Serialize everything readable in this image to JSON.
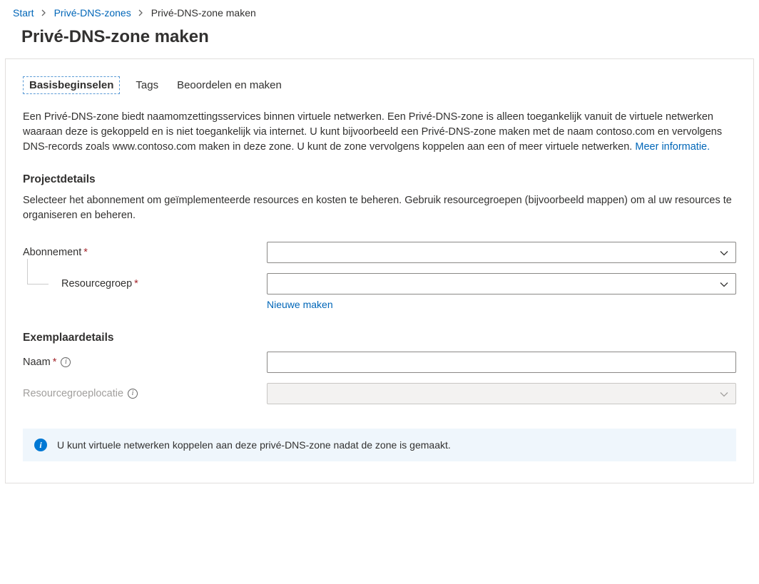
{
  "breadcrumb": {
    "items": [
      {
        "label": "Start",
        "link": true
      },
      {
        "label": "Privé-DNS-zones",
        "link": true
      },
      {
        "label": "Privé-DNS-zone maken",
        "link": false
      }
    ]
  },
  "page_title": "Privé-DNS-zone maken",
  "tabs": [
    {
      "label": "Basisbeginselen",
      "active": true
    },
    {
      "label": "Tags",
      "active": false
    },
    {
      "label": "Beoordelen en maken",
      "active": false
    }
  ],
  "intro": {
    "text": "Een Privé-DNS-zone biedt naamomzettingsservices binnen virtuele netwerken. Een Privé-DNS-zone is alleen toegankelijk vanuit de virtuele netwerken waaraan deze is gekoppeld en is niet toegankelijk via internet. U kunt bijvoorbeeld een Privé-DNS-zone maken met de naam contoso.com en vervolgens DNS-records zoals www.contoso.com maken in deze zone. U kunt de zone vervolgens koppelen aan een of meer virtuele netwerken. ",
    "more_link": "Meer informatie."
  },
  "project_details": {
    "title": "Projectdetails",
    "description": "Selecteer het abonnement om geïmplementeerde resources en kosten te beheren. Gebruik resourcegroepen (bijvoorbeeld mappen) om al uw resources te organiseren en beheren.",
    "subscription_label": "Abonnement",
    "subscription_value": "",
    "resource_group_label": "Resourcegroep",
    "resource_group_value": "",
    "create_new": "Nieuwe maken"
  },
  "instance_details": {
    "title": "Exemplaardetails",
    "name_label": "Naam",
    "name_value": "",
    "location_label": "Resourcegroeplocatie",
    "location_value": ""
  },
  "info_banner": {
    "text": "U kunt virtuele netwerken koppelen aan deze privé-DNS-zone nadat de zone is gemaakt."
  }
}
